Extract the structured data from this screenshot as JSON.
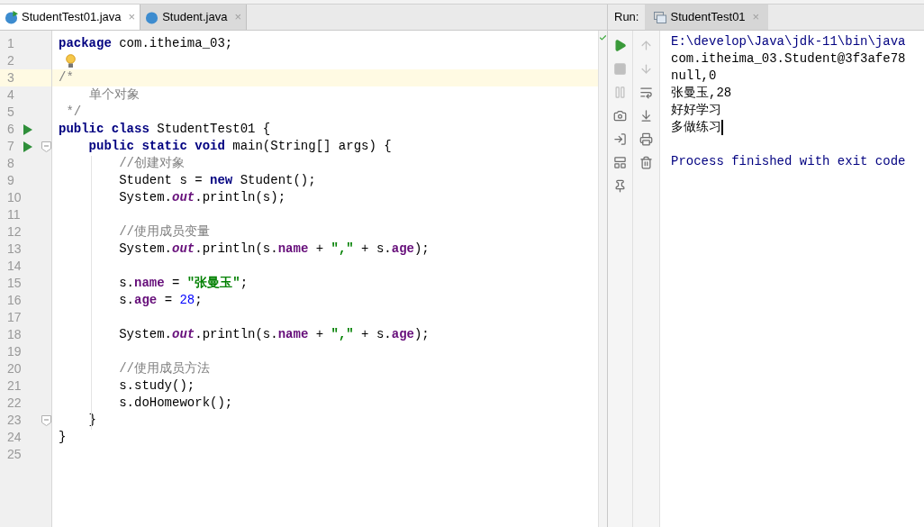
{
  "editor_tabs": [
    {
      "label": "StudentTest01.java",
      "close": "×",
      "selected": true,
      "runnable": true
    },
    {
      "label": "Student.java",
      "close": "×",
      "selected": false,
      "runnable": false
    }
  ],
  "editor": {
    "inspection_ok": true,
    "lines": [
      {
        "number": "1",
        "tokens": [
          {
            "kind": "kw",
            "text": "package"
          },
          {
            "kind": "plain",
            "text": " com.itheima_03;"
          }
        ]
      },
      {
        "number": "2",
        "bulb": true
      },
      {
        "number": "3",
        "current": true,
        "tokens": [
          {
            "kind": "comment",
            "text": "/*"
          }
        ]
      },
      {
        "number": "4",
        "tokens": [
          {
            "kind": "comment",
            "text": "    单个对象"
          }
        ]
      },
      {
        "number": "5",
        "tokens": [
          {
            "kind": "comment",
            "text": " */"
          }
        ]
      },
      {
        "number": "6",
        "runnable": true,
        "tokens": [
          {
            "kind": "kw",
            "text": "public class"
          },
          {
            "kind": "plain",
            "text": " StudentTest01 {"
          }
        ]
      },
      {
        "number": "7",
        "runnable": true,
        "fold": true,
        "tokens": [
          {
            "kind": "kw",
            "text": "    public static void"
          },
          {
            "kind": "plain",
            "text": " main(String[] args) {"
          }
        ]
      },
      {
        "number": "8",
        "tokens": [
          {
            "kind": "comment",
            "text": "        //创建对象"
          }
        ]
      },
      {
        "number": "9",
        "tokens": [
          {
            "kind": "plain",
            "text": "        Student s = "
          },
          {
            "kind": "kw",
            "text": "new"
          },
          {
            "kind": "plain",
            "text": " Student();"
          }
        ]
      },
      {
        "number": "10",
        "tokens": [
          {
            "kind": "plain",
            "text": "        System."
          },
          {
            "kind": "static",
            "text": "out"
          },
          {
            "kind": "plain",
            "text": ".println(s);"
          }
        ]
      },
      {
        "number": "11"
      },
      {
        "number": "12",
        "tokens": [
          {
            "kind": "comment",
            "text": "        //使用成员变量"
          }
        ]
      },
      {
        "number": "13",
        "tokens": [
          {
            "kind": "plain",
            "text": "        System."
          },
          {
            "kind": "static",
            "text": "out"
          },
          {
            "kind": "plain",
            "text": ".println(s."
          },
          {
            "kind": "field",
            "text": "name"
          },
          {
            "kind": "plain",
            "text": " + "
          },
          {
            "kind": "str",
            "text": "\",\""
          },
          {
            "kind": "plain",
            "text": " + s."
          },
          {
            "kind": "field",
            "text": "age"
          },
          {
            "kind": "plain",
            "text": ");"
          }
        ]
      },
      {
        "number": "14"
      },
      {
        "number": "15",
        "tokens": [
          {
            "kind": "plain",
            "text": "        s."
          },
          {
            "kind": "field",
            "text": "name"
          },
          {
            "kind": "plain",
            "text": " = "
          },
          {
            "kind": "str",
            "text": "\"张曼玉\""
          },
          {
            "kind": "plain",
            "text": ";"
          }
        ]
      },
      {
        "number": "16",
        "tokens": [
          {
            "kind": "plain",
            "text": "        s."
          },
          {
            "kind": "field",
            "text": "age"
          },
          {
            "kind": "plain",
            "text": " = "
          },
          {
            "kind": "num",
            "text": "28"
          },
          {
            "kind": "plain",
            "text": ";"
          }
        ]
      },
      {
        "number": "17"
      },
      {
        "number": "18",
        "tokens": [
          {
            "kind": "plain",
            "text": "        System."
          },
          {
            "kind": "static",
            "text": "out"
          },
          {
            "kind": "plain",
            "text": ".println(s."
          },
          {
            "kind": "field",
            "text": "name"
          },
          {
            "kind": "plain",
            "text": " + "
          },
          {
            "kind": "str",
            "text": "\",\""
          },
          {
            "kind": "plain",
            "text": " + s."
          },
          {
            "kind": "field",
            "text": "age"
          },
          {
            "kind": "plain",
            "text": ");"
          }
        ]
      },
      {
        "number": "19"
      },
      {
        "number": "20",
        "tokens": [
          {
            "kind": "comment",
            "text": "        //使用成员方法"
          }
        ]
      },
      {
        "number": "21",
        "tokens": [
          {
            "kind": "plain",
            "text": "        s.study();"
          }
        ]
      },
      {
        "number": "22",
        "tokens": [
          {
            "kind": "plain",
            "text": "        s.doHomework();"
          }
        ]
      },
      {
        "number": "23",
        "fold": true,
        "tokens": [
          {
            "kind": "plain",
            "text": "    }"
          }
        ]
      },
      {
        "number": "24",
        "tokens": [
          {
            "kind": "plain",
            "text": "}"
          }
        ]
      },
      {
        "number": "25"
      }
    ]
  },
  "run_panel": {
    "label": "Run:",
    "tabs": [
      {
        "label": "StudentTest01",
        "close": "×",
        "selected": true
      }
    ],
    "toolbar_left": [
      {
        "kind": "rerun",
        "disabled": false
      },
      {
        "kind": "stop",
        "disabled": true
      },
      {
        "kind": "pause",
        "disabled": true
      },
      {
        "kind": "dump",
        "disabled": false
      },
      {
        "kind": "restore",
        "disabled": false
      },
      {
        "kind": "layout",
        "disabled": false
      },
      {
        "kind": "pin",
        "disabled": false
      }
    ],
    "toolbar_right": [
      {
        "kind": "up",
        "disabled": true
      },
      {
        "kind": "down",
        "disabled": true
      },
      {
        "kind": "wrap",
        "disabled": false
      },
      {
        "kind": "scroll_end",
        "disabled": false
      },
      {
        "kind": "print",
        "disabled": false
      },
      {
        "kind": "clear",
        "disabled": false
      }
    ],
    "console": [
      {
        "kind": "system",
        "text": "E:\\develop\\Java\\jdk-11\\bin\\java"
      },
      {
        "kind": "output",
        "text": "com.itheima_03.Student@3f3afe78"
      },
      {
        "kind": "output",
        "text": "null,0"
      },
      {
        "kind": "output",
        "text": "张曼玉,28"
      },
      {
        "kind": "output",
        "text": "好好学习"
      },
      {
        "kind": "output",
        "text": "多做练习",
        "caret": true
      },
      {
        "kind": "blank"
      },
      {
        "kind": "system",
        "text": "Process finished with exit code"
      }
    ]
  }
}
